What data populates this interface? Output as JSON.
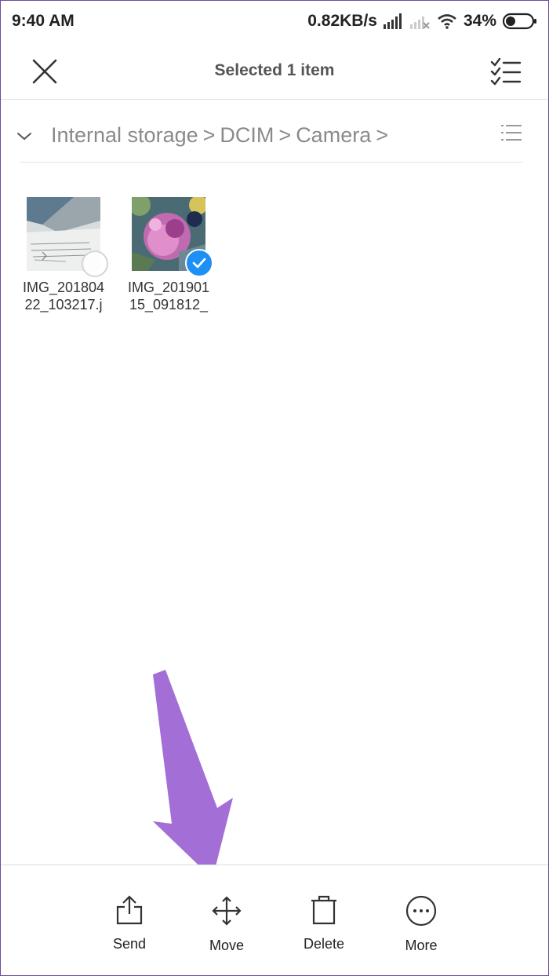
{
  "status_bar": {
    "time": "9:40 AM",
    "network_speed": "0.82KB/s",
    "battery": "34%",
    "icons": [
      "signal-icon",
      "signal-off-icon",
      "wifi-icon",
      "battery-icon"
    ]
  },
  "toolbar": {
    "title": "Selected 1 item",
    "close_icon": "close-icon",
    "select_all_icon": "select-all-icon"
  },
  "breadcrumb": {
    "items": [
      "Internal storage",
      "DCIM",
      "Camera"
    ],
    "separator": ">"
  },
  "files": [
    {
      "name": "IMG_20180422_103217.j",
      "line1": "IMG_201804",
      "line2": "22_103217.j",
      "selected": false
    },
    {
      "name": "IMG_20190115_091812_",
      "line1": "IMG_201901",
      "line2": "15_091812_",
      "selected": true
    }
  ],
  "actions": [
    {
      "label": "Send",
      "icon": "share-icon"
    },
    {
      "label": "Move",
      "icon": "move-icon"
    },
    {
      "label": "Delete",
      "icon": "trash-icon"
    },
    {
      "label": "More",
      "icon": "more-icon"
    }
  ],
  "colors": {
    "accent": "#1e90f5",
    "annotation_arrow": "#a36fd6"
  }
}
